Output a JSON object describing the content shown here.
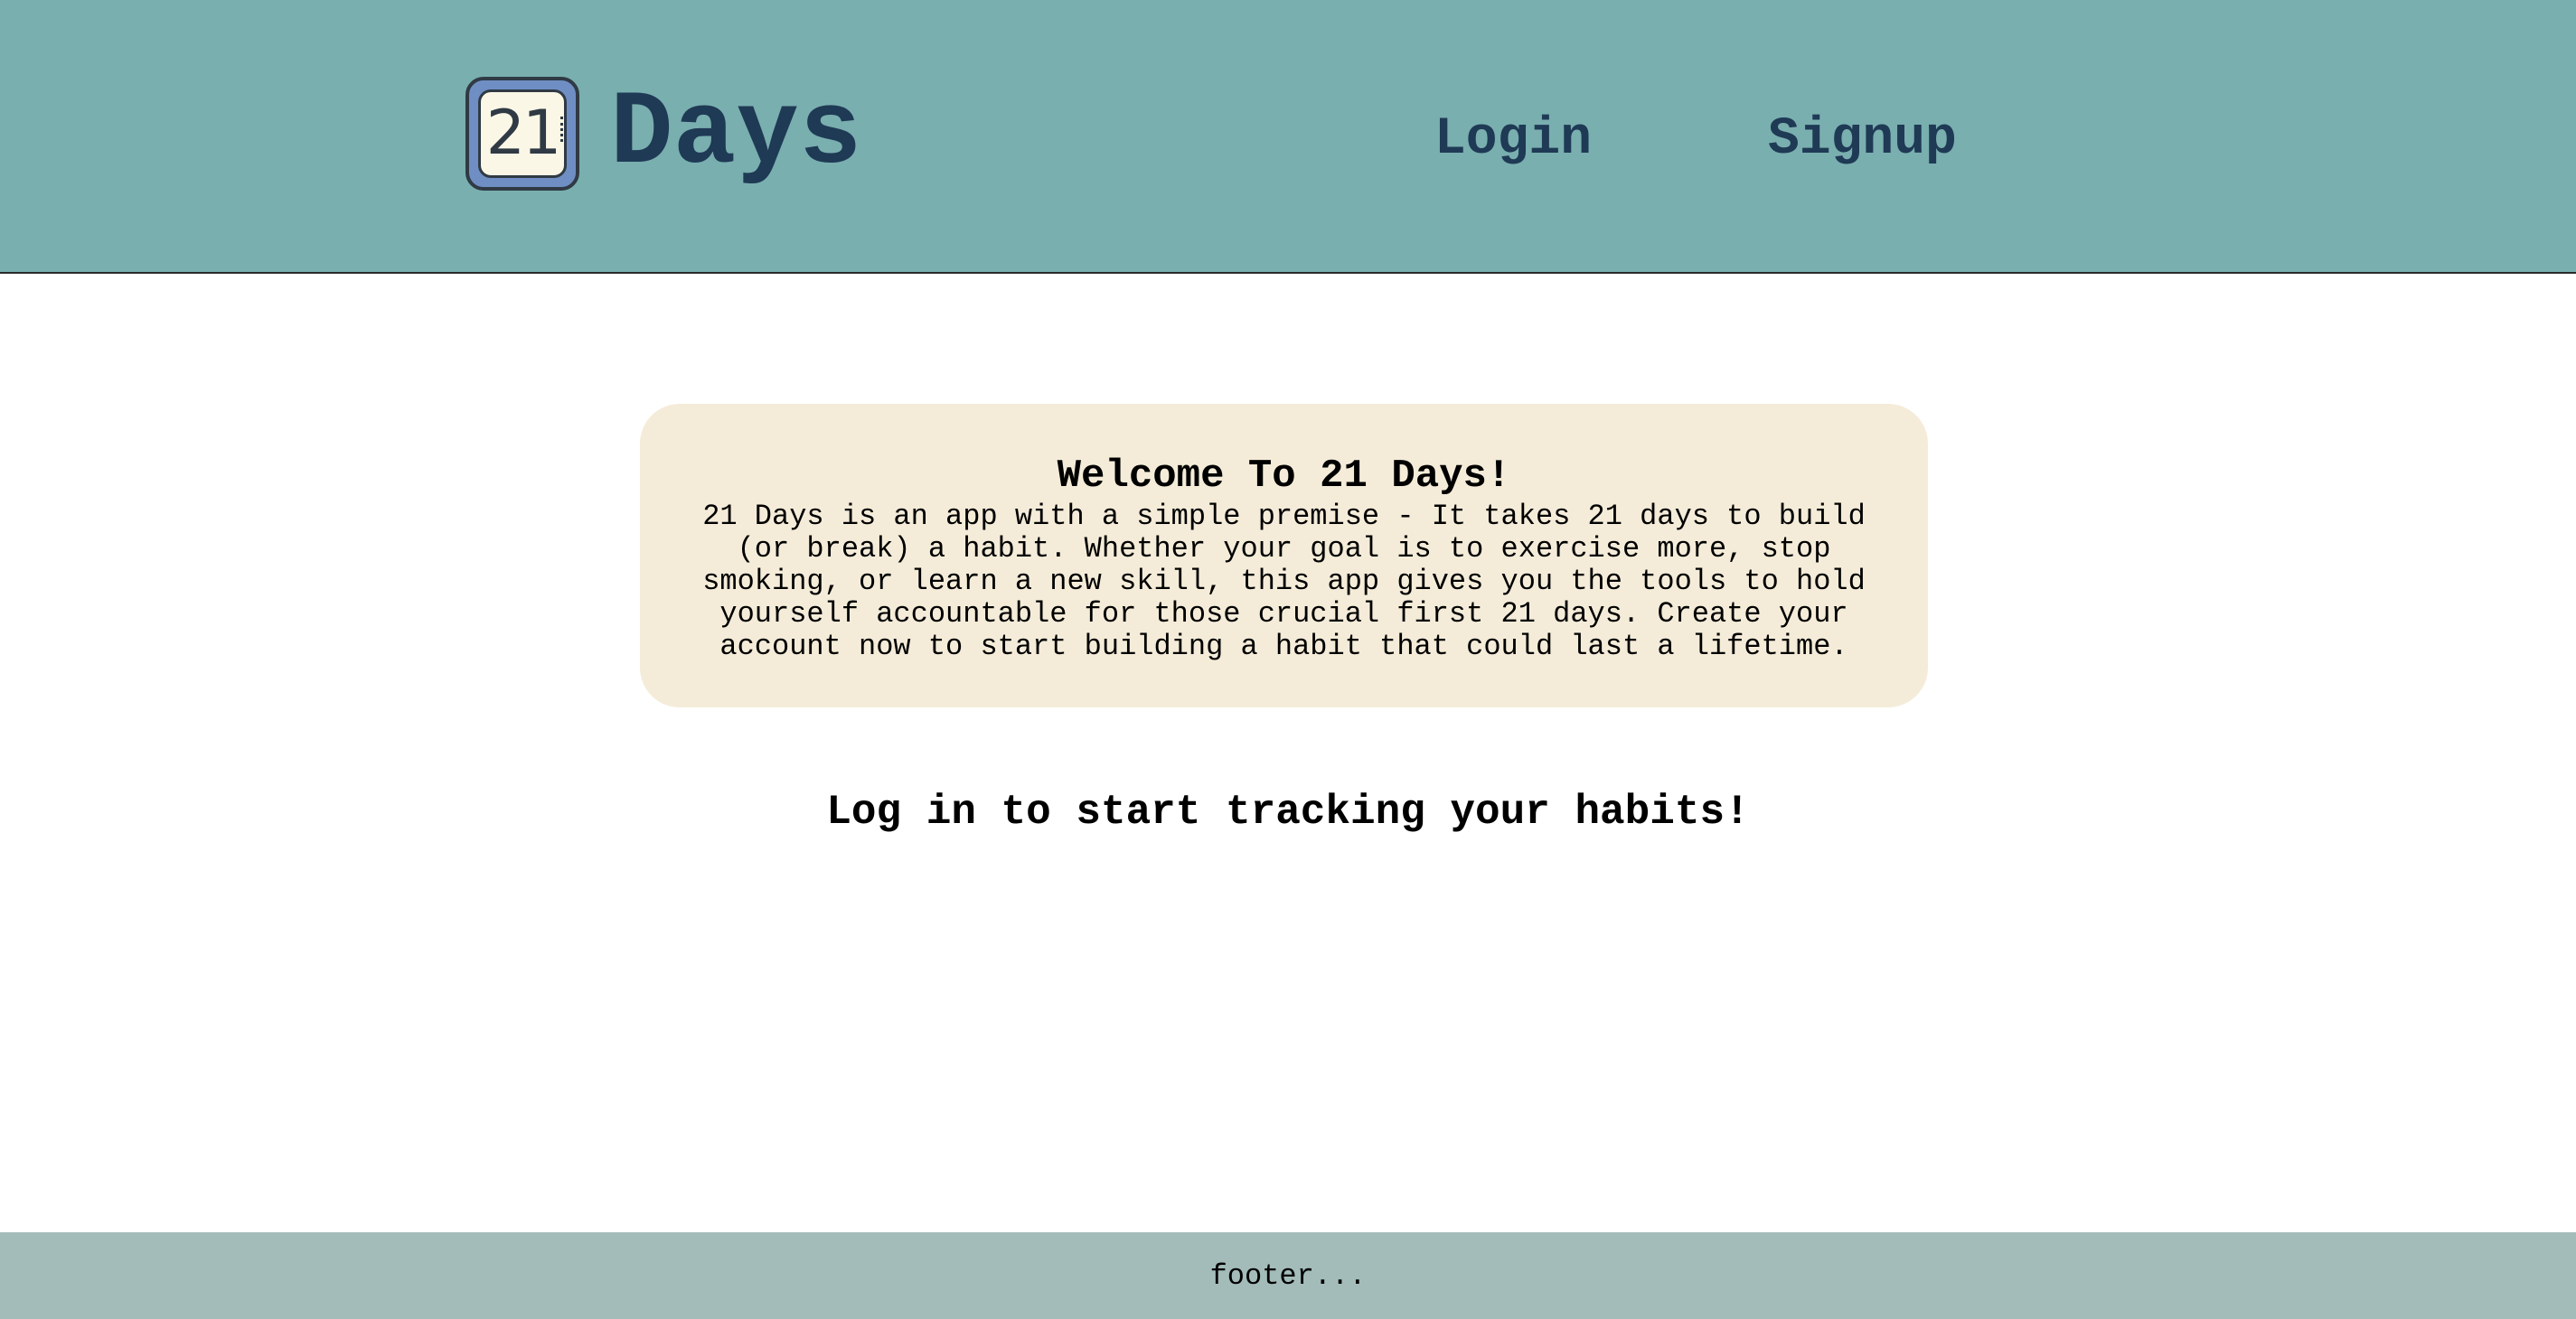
{
  "header": {
    "logo_number": "21",
    "brand_title": "Days",
    "nav": {
      "login_label": "Login",
      "signup_label": "Signup"
    }
  },
  "main": {
    "welcome": {
      "title": "Welcome To 21 Days!",
      "body": "21 Days is an app with a simple premise - It takes 21 days to build (or break) a habit. Whether your goal is to exercise more, stop smoking, or learn a new skill, this app gives you the tools to hold yourself accountable for those crucial first 21 days. Create your account now to start building a habit that could last a lifetime."
    },
    "cta_text": "Log in to start tracking your habits!"
  },
  "footer": {
    "text": "footer..."
  },
  "colors": {
    "header_bg": "#7aafb0",
    "brand_text": "#1f3a55",
    "card_bg": "#f4ecd8",
    "footer_bg": "#a3bcba",
    "logo_blue": "#6f8fc4"
  },
  "icons": {
    "logo": "calendar-icon"
  }
}
